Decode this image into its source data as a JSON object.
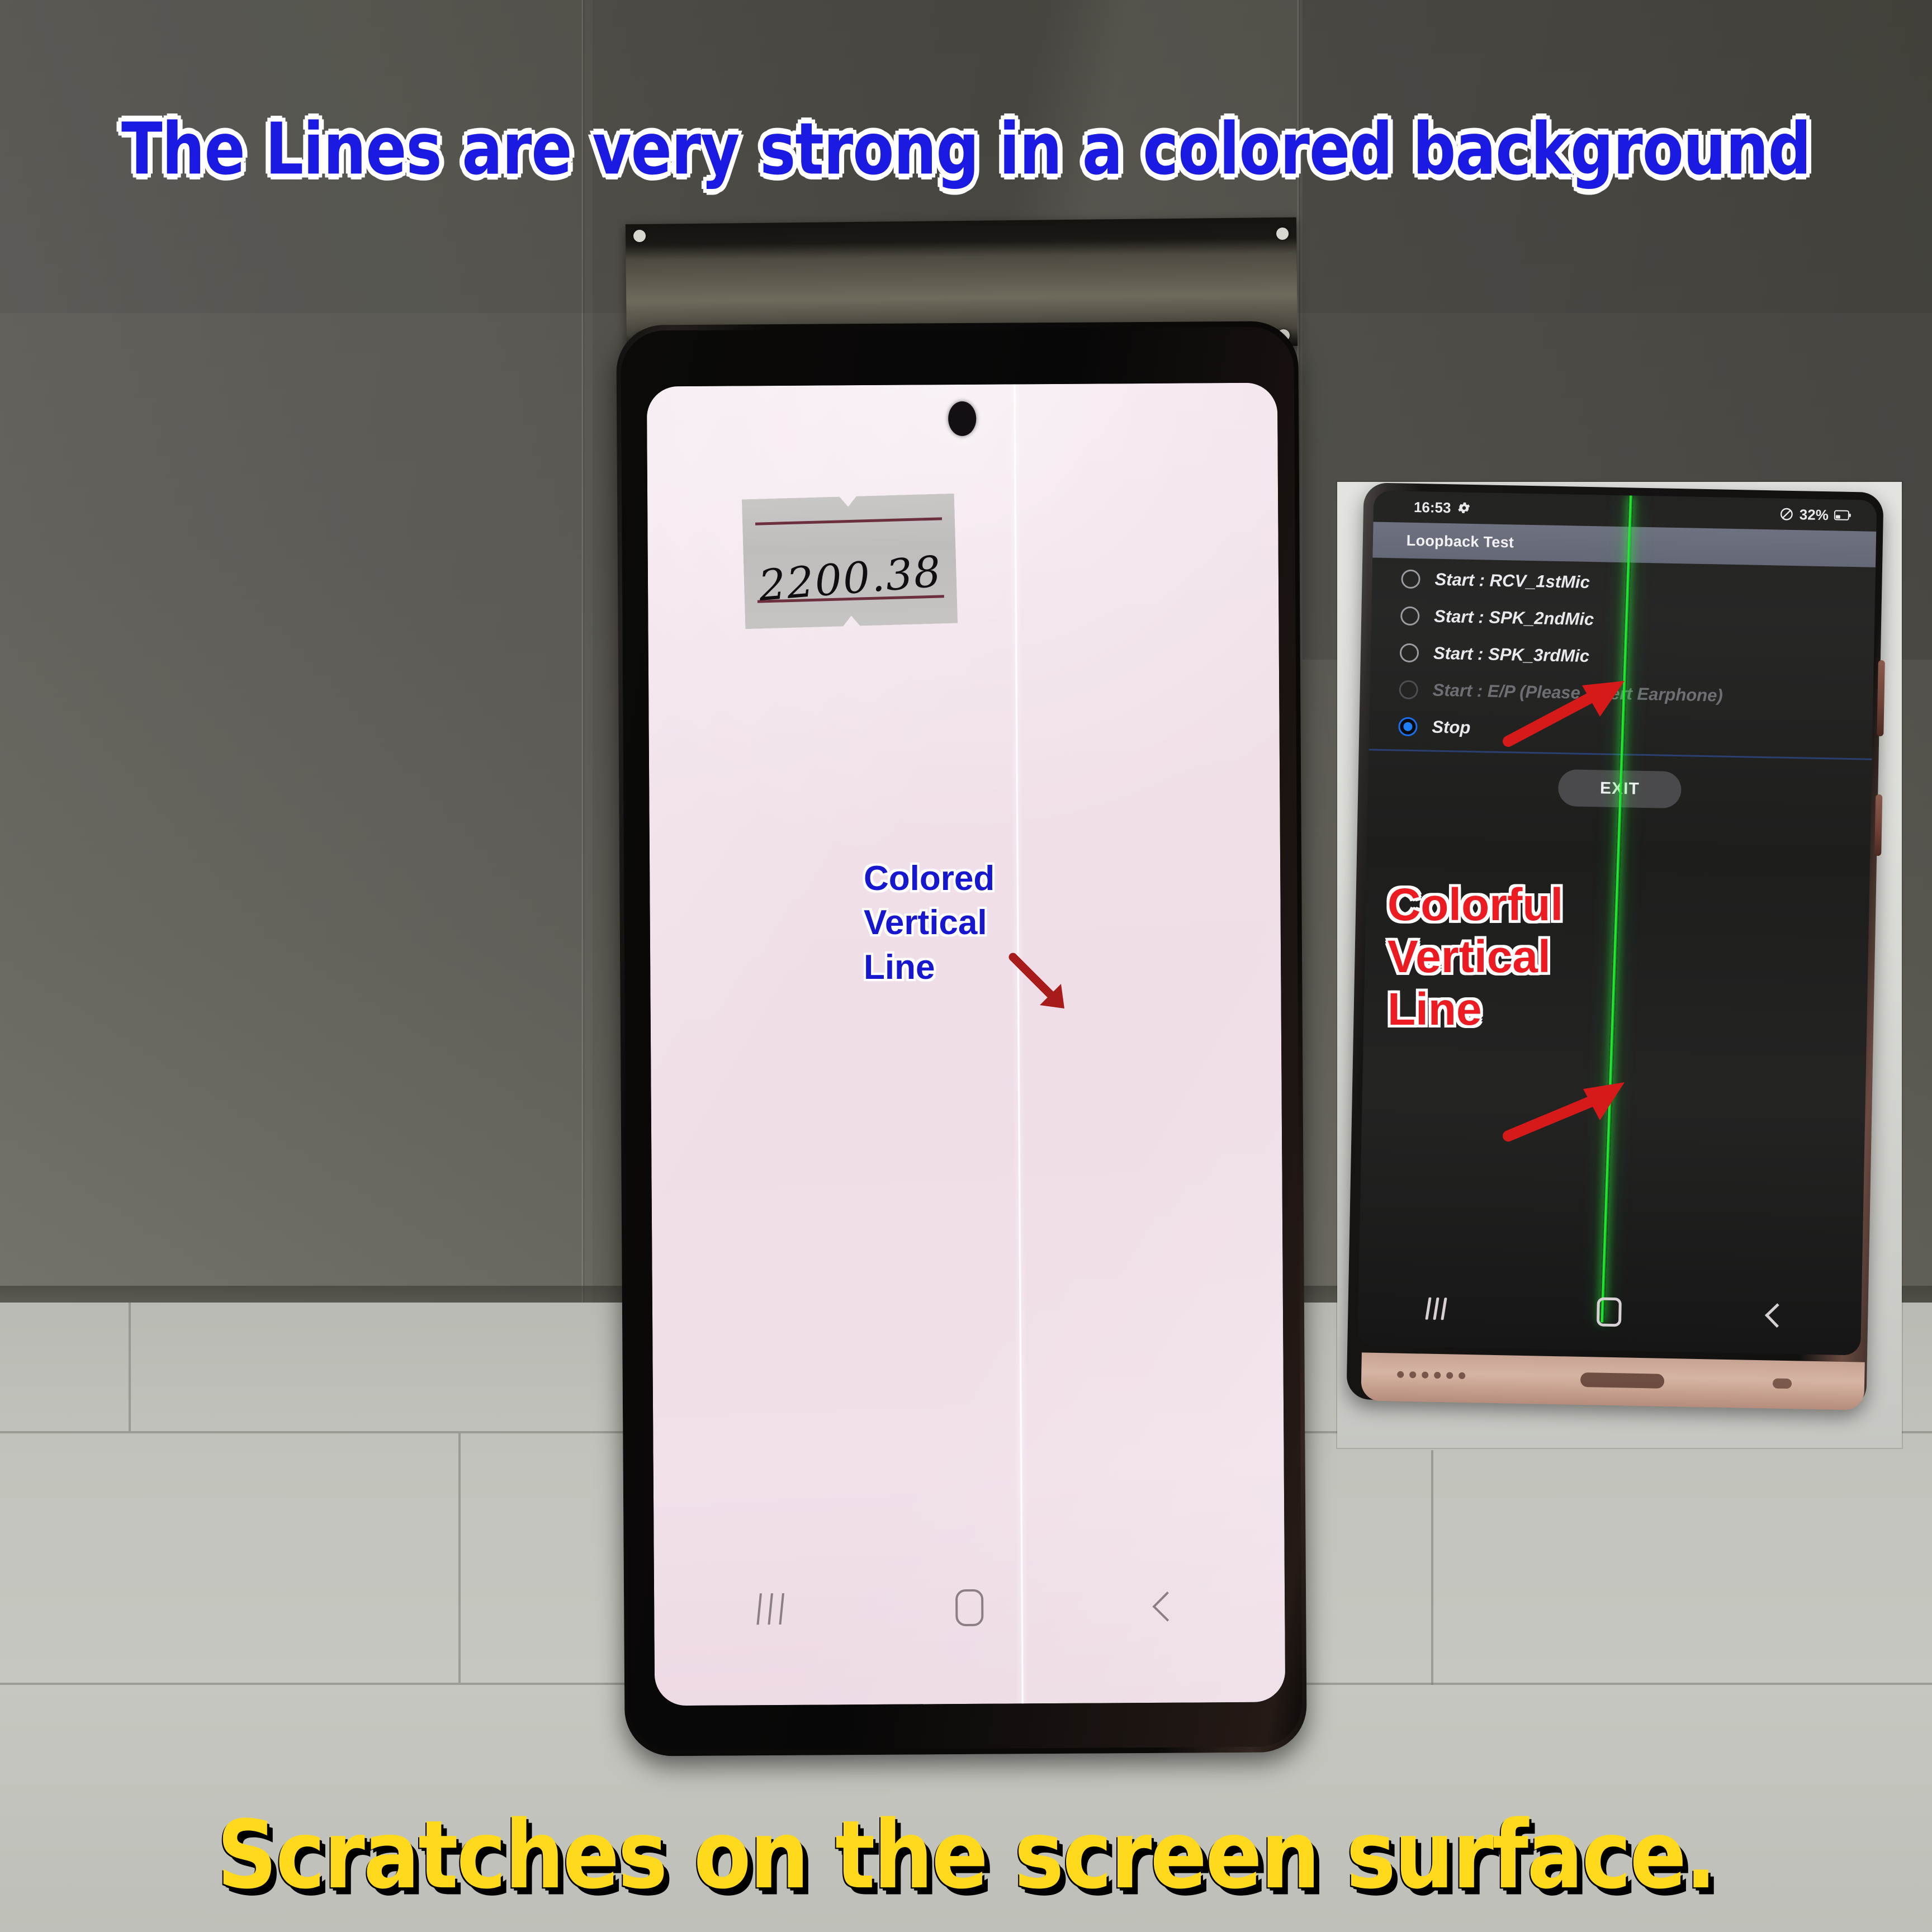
{
  "titles": {
    "top": "The Lines are very strong in a colored background",
    "bottom": "Scratches on the screen surface."
  },
  "colors": {
    "title_top": "#1a1ae2",
    "title_bottom": "#ffd91c",
    "annotation_main": "#1717cf",
    "annotation_inset": "#ec1b22",
    "defect_line_main": "#ffffff",
    "defect_line_inset": "#0bdb20",
    "arrow_main": "#a81b1b",
    "arrow_inset": "#d61a1a",
    "radio_selected": "#1f7ef5"
  },
  "main_phone": {
    "annotation_lines": [
      "Colored",
      "Vertical",
      "Line"
    ],
    "sticker_text": "2200.38",
    "nav": [
      {
        "name": "recents",
        "icon": "recents-icon"
      },
      {
        "name": "home",
        "icon": "home-icon"
      },
      {
        "name": "back",
        "icon": "back-icon"
      }
    ]
  },
  "inset_phone": {
    "annotation_lines": [
      "Colorful",
      "Vertical",
      "Line"
    ],
    "status_bar": {
      "time": "16:53",
      "settings_icon": "gear-icon",
      "dnd_icon": "do-not-disturb-icon",
      "battery_percent": "32%",
      "battery_icon": "battery-icon"
    },
    "app_bar_title": "Loopback Test",
    "options": [
      {
        "label": "Start : RCV_1stMic",
        "selected": false,
        "disabled": false
      },
      {
        "label": "Start : SPK_2ndMic",
        "selected": false,
        "disabled": false
      },
      {
        "label": "Start : SPK_3rdMic",
        "selected": false,
        "disabled": false
      },
      {
        "label": "Start : E/P (Please insert Earphone)",
        "selected": false,
        "disabled": true
      },
      {
        "label": "Stop",
        "selected": true,
        "disabled": false
      }
    ],
    "exit_button_label": "EXIT",
    "nav": [
      {
        "name": "recents",
        "icon": "recents-icon"
      },
      {
        "name": "home",
        "icon": "home-icon"
      },
      {
        "name": "back",
        "icon": "back-icon"
      }
    ]
  }
}
